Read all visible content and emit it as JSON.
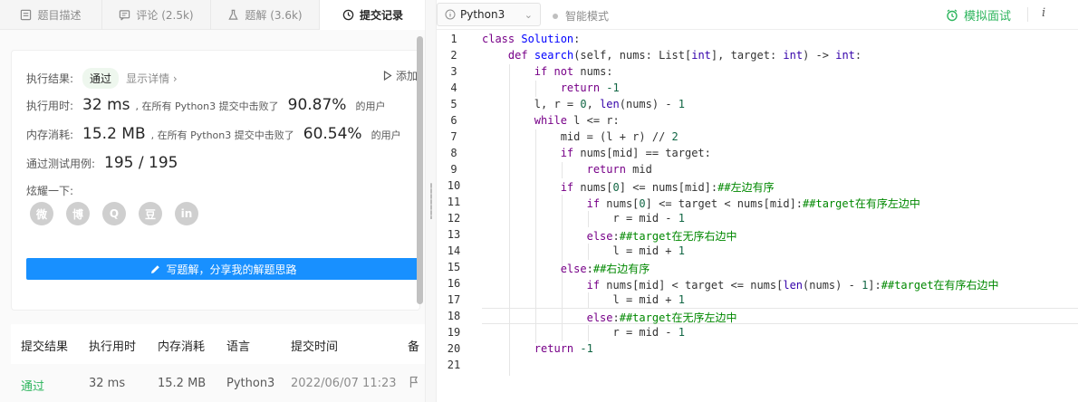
{
  "tabs": [
    {
      "label": "题目描述",
      "icon": "description-icon"
    },
    {
      "label": "评论 (2.5k)",
      "icon": "comment-icon"
    },
    {
      "label": "题解 (3.6k)",
      "icon": "flask-icon"
    },
    {
      "label": "提交记录",
      "icon": "clock-icon"
    }
  ],
  "result": {
    "status_label": "执行结果:",
    "status": "通过",
    "details_link": "显示详情 ›",
    "add_link": "添加",
    "time_label": "执行用时:",
    "time_value": "32 ms",
    "time_text": ", 在所有 Python3 提交中击败了",
    "time_pct": "90.87%",
    "users_text": "的用户",
    "mem_label": "内存消耗:",
    "mem_value": "15.2 MB",
    "mem_text": ", 在所有 Python3 提交中击败了",
    "mem_pct": "60.54%",
    "cases_label": "通过测试用例:",
    "cases_value": "195 / 195",
    "share_label": "炫耀一下:",
    "share_icons": [
      "wechat-icon",
      "weibo-icon",
      "qq-icon",
      "douban-icon",
      "linkedin-icon"
    ],
    "share_glyphs": [
      "微",
      "博",
      "Q",
      "豆",
      "in"
    ],
    "write_button": "写题解，分享我的解题思路"
  },
  "submissions": {
    "headers": [
      "提交结果",
      "执行用时",
      "内存消耗",
      "语言",
      "提交时间",
      "备"
    ],
    "rows": [
      [
        "通过",
        "32 ms",
        "15.2 MB",
        "Python3",
        "2022/06/07 11:23"
      ]
    ]
  },
  "toolbar": {
    "language": "Python3",
    "smart_mode": "智能模式",
    "interview": "模拟面试",
    "info": "i"
  },
  "colors": {
    "accent_blue": "#1890ff",
    "accent_green": "#2db55d",
    "keyword": "#770088",
    "comment": "#008800"
  }
}
